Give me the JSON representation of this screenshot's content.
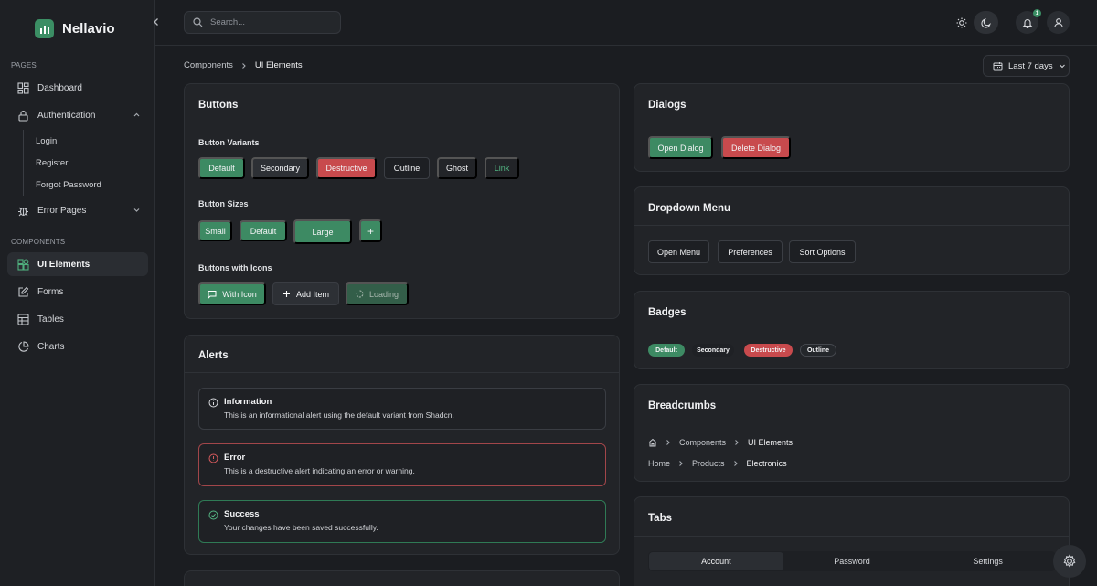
{
  "brand": {
    "name": "Nellavio"
  },
  "sidebar": {
    "pages_label": "Pages",
    "components_label": "Components",
    "items": {
      "dashboard": "Dashboard",
      "authentication": "Authentication",
      "login": "Login",
      "register": "Register",
      "forgot_password": "Forgot Password",
      "error_pages": "Error Pages",
      "ui_elements": "UI Elements",
      "forms": "Forms",
      "tables": "Tables",
      "charts": "Charts"
    }
  },
  "topbar": {
    "search_placeholder": "Search...",
    "notification_count": "1"
  },
  "breadcrumb": {
    "parent": "Components",
    "current": "UI Elements"
  },
  "date_range": {
    "label": "Last 7 days"
  },
  "buttons_card": {
    "title": "Buttons",
    "variants_label": "Button Variants",
    "variants": {
      "default": "Default",
      "secondary": "Secondary",
      "destructive": "Destructive",
      "outline": "Outline",
      "ghost": "Ghost",
      "link": "Link"
    },
    "sizes_label": "Button Sizes",
    "sizes": {
      "small": "Small",
      "default": "Default",
      "large": "Large",
      "icon": "+"
    },
    "icons_label": "Buttons with Icons",
    "icon_buttons": {
      "with_icon": "With Icon",
      "add_item": "Add Item",
      "loading": "Loading"
    }
  },
  "alerts_card": {
    "title": "Alerts",
    "alerts": [
      {
        "title": "Information",
        "description": "This is an informational alert using the default variant from Shadcn."
      },
      {
        "title": "Error",
        "description": "This is a destructive alert indicating an error or warning."
      },
      {
        "title": "Success",
        "description": "Your changes have been saved successfully."
      }
    ]
  },
  "dialogs_card": {
    "title": "Dialogs",
    "open": "Open Dialog",
    "delete": "Delete Dialog"
  },
  "dropdown_card": {
    "title": "Dropdown Menu",
    "open_menu": "Open Menu",
    "preferences": "Preferences",
    "sort_options": "Sort Options"
  },
  "badges_card": {
    "title": "Badges",
    "badges": {
      "default": "Default",
      "secondary": "Secondary",
      "destructive": "Destructive",
      "outline": "Outline"
    }
  },
  "breadcrumbs_card": {
    "title": "Breadcrumbs",
    "first": {
      "components": "Components",
      "current": "UI Elements"
    },
    "second": {
      "home": "Home",
      "products": "Products",
      "current": "Electronics"
    }
  },
  "tabs_card": {
    "title": "Tabs",
    "tabs": [
      "Account",
      "Password",
      "Settings"
    ]
  },
  "colors": {
    "accent": "#3d8a63",
    "destructive": "#c84a4d",
    "background": "#1b1d21"
  }
}
